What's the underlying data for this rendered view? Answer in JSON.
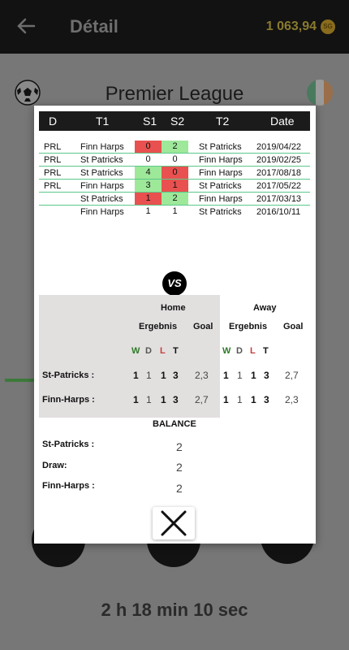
{
  "header": {
    "title": "Détail",
    "coins": "1 063,94",
    "coin_badge": "SG"
  },
  "league": "Premier League",
  "flag_colors": [
    "#169b62",
    "#ffffff",
    "#ff883e"
  ],
  "timer": "2 h 18 min 10 sec",
  "table": {
    "columns": [
      "D",
      "T1",
      "S1",
      "S2",
      "T2",
      "Date"
    ],
    "rows": [
      {
        "d": "PRL",
        "t1": "Finn Harps",
        "s1": "0",
        "s2": "2",
        "t2": "St Patricks",
        "date": "2019/04/22",
        "c1": "red",
        "c2": "green"
      },
      {
        "d": "PRL",
        "t1": "St Patricks",
        "s1": "0",
        "s2": "0",
        "t2": "Finn Harps",
        "date": "2019/02/25",
        "c1": "",
        "c2": ""
      },
      {
        "d": "PRL",
        "t1": "St Patricks",
        "s1": "4",
        "s2": "0",
        "t2": "Finn Harps",
        "date": "2017/08/18",
        "c1": "green",
        "c2": "red"
      },
      {
        "d": "PRL",
        "t1": "Finn Harps",
        "s1": "3",
        "s2": "1",
        "t2": "St Patricks",
        "date": "2017/05/22",
        "c1": "green",
        "c2": "red"
      },
      {
        "d": "",
        "t1": "St Patricks",
        "s1": "1",
        "s2": "2",
        "t2": "Finn Harps",
        "date": "2017/03/13",
        "c1": "red",
        "c2": "green"
      },
      {
        "d": "",
        "t1": "Finn Harps",
        "s1": "1",
        "s2": "1",
        "t2": "St Patricks",
        "date": "2016/10/11",
        "c1": "",
        "c2": ""
      }
    ]
  },
  "vs_label": "VS",
  "stats": {
    "home_label": "Home",
    "away_label": "Away",
    "result_label": "Ergebnis",
    "goal_label": "Goal",
    "w": "W",
    "d": "D",
    "l": "L",
    "t": "T",
    "team1": {
      "name": "St-Patricks :",
      "home": [
        "1",
        "1",
        "1",
        "3"
      ],
      "home_goal": "2,3",
      "away": [
        "1",
        "1",
        "1",
        "3"
      ],
      "away_goal": "2,7"
    },
    "team2": {
      "name": "Finn-Harps :",
      "home": [
        "1",
        "1",
        "1",
        "3"
      ],
      "home_goal": "2,7",
      "away": [
        "1",
        "1",
        "1",
        "3"
      ],
      "away_goal": "2,3"
    }
  },
  "balance": {
    "title": "BALANCE",
    "rows": [
      {
        "label": "St-Patricks :",
        "value": "2"
      },
      {
        "label": "Draw:",
        "value": "2"
      },
      {
        "label": "Finn-Harps :",
        "value": "2"
      }
    ]
  }
}
